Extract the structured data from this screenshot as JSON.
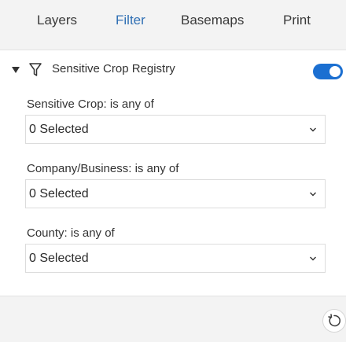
{
  "tabs": [
    {
      "label": "Layers"
    },
    {
      "label": "Filter"
    },
    {
      "label": "Basemaps"
    },
    {
      "label": "Print"
    }
  ],
  "active_tab": "Filter",
  "filter_group": {
    "title": "Sensitive Crop Registry",
    "enabled": true,
    "collapse_icon": "caret-down-icon",
    "group_icon": "funnel-icon"
  },
  "fields": [
    {
      "label": "Sensitive Crop: is any of",
      "value": "0 Selected"
    },
    {
      "label": "Company/Business: is any of",
      "value": "0 Selected"
    },
    {
      "label": "County: is any of",
      "value": "0 Selected"
    }
  ],
  "footer": {
    "reset_icon": "reset-icon"
  },
  "colors": {
    "accent": "#2f6fb4",
    "toggle_on": "#1b6fd1",
    "panel_bg": "#f3f3f3"
  }
}
